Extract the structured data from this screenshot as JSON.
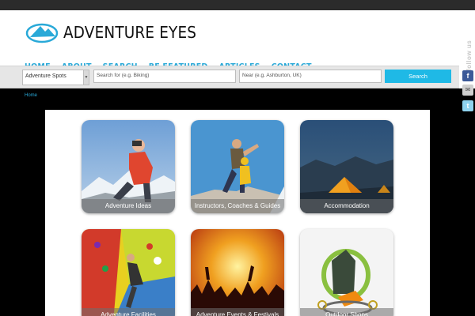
{
  "site": {
    "title": "ADVENTURE EYES"
  },
  "nav": [
    "HOME",
    "ABOUT",
    "SEARCH",
    "BE FEATURED",
    "ARTICLES",
    "CONTACT"
  ],
  "search": {
    "category_value": "Adventure Spots",
    "what_placeholder": "Search for (e.g. Biking)",
    "where_placeholder": "Near (e.g. Ashburton, UK)",
    "button_label": "Search"
  },
  "follow": {
    "label": "follow us",
    "icons": [
      "facebook-icon",
      "email-icon",
      "twitter-icon"
    ]
  },
  "breadcrumb": "Home",
  "tiles": [
    {
      "label": "Adventure Ideas",
      "image": "hiker-with-binoculars-photo"
    },
    {
      "label": "Instructors, Coaches & Guides",
      "image": "climbers-on-rock-photo"
    },
    {
      "label": "Accommodation",
      "image": "tent-at-night-photo"
    },
    {
      "label": "Adventure Facilities",
      "image": "climbing-wall-photo"
    },
    {
      "label": "Adventure Events & Festivals",
      "image": "concert-crowd-photo"
    },
    {
      "label": "Outdoor Shops",
      "image": "climbing-gear-photo"
    }
  ],
  "colors": {
    "accent": "#29a9d8",
    "button": "#1fb9e6",
    "topbar": "#2b2b2b",
    "background": "#000000"
  }
}
